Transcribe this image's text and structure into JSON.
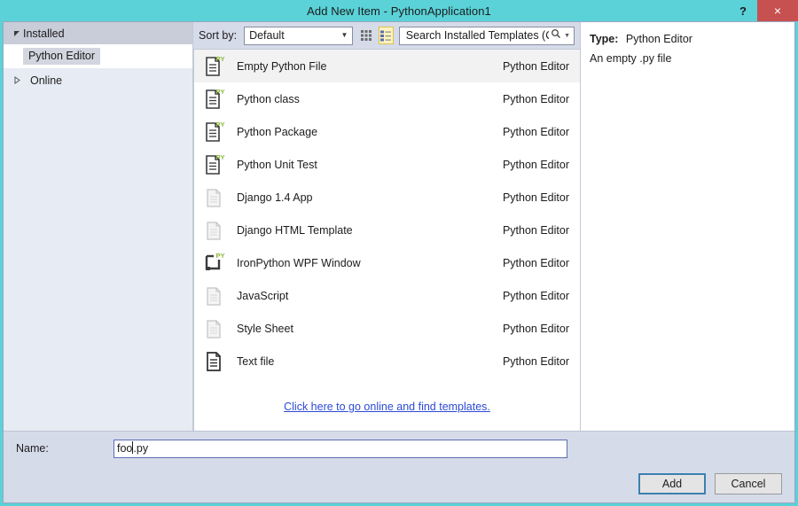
{
  "window": {
    "title": "Add New Item - PythonApplication1",
    "help_icon": "?",
    "close_icon": "×",
    "titlebar_color": "#5ad2d8",
    "close_button_color": "#c75050"
  },
  "sidebar": {
    "groups": [
      {
        "label": "Installed",
        "expanded": true,
        "icon": "triangle-down-icon"
      }
    ],
    "children": [
      {
        "label": "Python Editor",
        "selected": true
      }
    ],
    "collapsed": [
      {
        "label": "Online",
        "expanded": false,
        "icon": "triangle-right-icon"
      }
    ]
  },
  "toolbar": {
    "sort_by_label": "Sort by:",
    "sort_by_value": "Default",
    "sort_by_options": [
      "Default"
    ],
    "grid_view_icon": "grid-view-icon",
    "list_view_icon": "list-view-icon",
    "active_view": "list",
    "active_view_highlight": "#fdf4bf"
  },
  "search": {
    "placeholder": "Search Installed Templates (Ctrl+E)",
    "value": "",
    "icon": "search-icon",
    "dropdown_icon": "chevron-down-icon"
  },
  "templates": {
    "items": [
      {
        "name": "Empty Python File",
        "origin": "Python Editor",
        "icon": "python-file-icon",
        "selected": true
      },
      {
        "name": "Python class",
        "origin": "Python Editor",
        "icon": "python-file-icon",
        "selected": false
      },
      {
        "name": "Python Package",
        "origin": "Python Editor",
        "icon": "python-file-icon",
        "selected": false
      },
      {
        "name": "Python Unit Test",
        "origin": "Python Editor",
        "icon": "python-file-icon",
        "selected": false
      },
      {
        "name": "Django 1.4 App",
        "origin": "Python Editor",
        "icon": "blank-file-icon",
        "selected": false
      },
      {
        "name": "Django HTML Template",
        "origin": "Python Editor",
        "icon": "blank-file-icon",
        "selected": false
      },
      {
        "name": "IronPython WPF Window",
        "origin": "Python Editor",
        "icon": "wpf-window-icon",
        "selected": false
      },
      {
        "name": "JavaScript",
        "origin": "Python Editor",
        "icon": "blank-file-icon",
        "selected": false
      },
      {
        "name": "Style Sheet",
        "origin": "Python Editor",
        "icon": "blank-file-icon",
        "selected": false
      },
      {
        "name": "Text file",
        "origin": "Python Editor",
        "icon": "text-file-icon",
        "selected": false
      }
    ],
    "online_link": "Click here to go online and find templates.",
    "link_color": "#2b4ad6"
  },
  "details": {
    "type_label": "Type:",
    "type_value": "Python Editor",
    "description": "An empty .py file"
  },
  "bottom": {
    "name_label": "Name:",
    "name_value_before_caret": "foo",
    "name_value_after_caret": ".py",
    "name_full_value": "foo.py",
    "add_label": "Add",
    "cancel_label": "Cancel",
    "focused_button": "Add"
  }
}
